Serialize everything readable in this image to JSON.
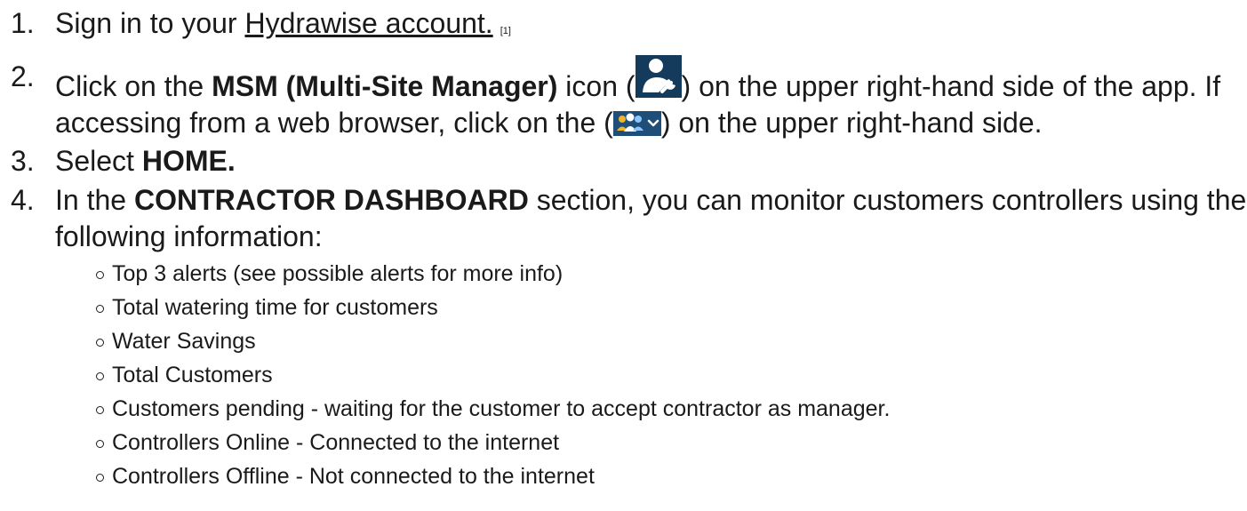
{
  "steps": [
    {
      "number": "1.",
      "text_before": "Sign in to your ",
      "link_text": "Hydrawise account.",
      "ref": "[1]"
    },
    {
      "number": "2.",
      "text_before": "Click on the ",
      "bold": "MSM (Multi-Site Manager)",
      "text_mid": " icon (",
      "icon": "msm-manager-icon",
      "text_after": ") on the upper right-hand side of the app. If accessing from a web browser, click on the (",
      "icon2": "users-dropdown-icon",
      "text_end": ") on the upper right-hand side."
    },
    {
      "number": "3.",
      "text_before": "Select ",
      "bold": "HOME."
    },
    {
      "number": "4.",
      "text_before": "In the ",
      "bold": "CONTRACTOR DASHBOARD",
      "text_after": " section, you can monitor customers controllers using the following information:",
      "items": [
        "Top 3 alerts (see possible alerts for more info)",
        "Total watering time for customers",
        "Water Savings",
        "Total Customers",
        "Customers pending - waiting for the customer to accept contractor as manager.",
        "Controllers Online - Connected to the internet",
        "Controllers Offline - Not connected to the internet"
      ]
    }
  ],
  "colors": {
    "text": "#1a1a1a",
    "icon_bg": "#143a5c",
    "web_icon_bg": "#1f4e79"
  }
}
